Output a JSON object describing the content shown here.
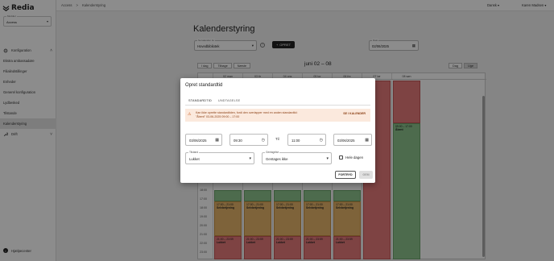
{
  "app": {
    "logo_text": "Redia"
  },
  "sidebar": {
    "access_label": "Moduler",
    "access_value": "Access",
    "items": [
      {
        "label": "Konfiguration",
        "icon": "gear-icon",
        "expandable": true
      },
      {
        "label": "Ekstra ambassadøre"
      },
      {
        "label": "Filialindstillinger"
      },
      {
        "label": "Enheder"
      },
      {
        "label": "Generel konfiguration"
      },
      {
        "label": "Lydbesked"
      },
      {
        "label": "Tilstande"
      },
      {
        "label": "Kalenderstyring",
        "active": true
      },
      {
        "label": "Drift",
        "icon": "wrench-icon",
        "expandable": true
      }
    ],
    "help_label": "Hjælpecenter"
  },
  "topbar": {
    "breadcrumb": [
      "Access",
      ">",
      "Kalenderstyring"
    ],
    "language": "Dansk",
    "user": "Karen Madsen"
  },
  "page": {
    "title": "Kalenderstyring",
    "calendar_select_label": "Se kalender for",
    "calendar_select_value": "Hovedbibliotek",
    "create_button": "OPRET",
    "date_label": "Dato",
    "date_value": "02/06/2025",
    "nav_buttons": [
      "I dag",
      "Tilbage",
      "Næste"
    ],
    "week_label": "juni 02 – 08",
    "view_buttons": [
      "Dag",
      "Uge"
    ],
    "day_headers": [
      "",
      "02 man",
      "03 tir",
      "04 ons",
      "05 tor",
      "06 fre",
      "07 lør",
      "08 søn"
    ],
    "hours": [
      "18:00",
      "17:00",
      "18:00",
      "19:00",
      "20:00",
      "21:00",
      "22:00",
      "23:00"
    ]
  },
  "calendar_events": {
    "closed_label": "Lukket",
    "self_service_label": "Selvbetjening",
    "open_label": "Åbent",
    "self_service_time": "17:00 – 21:00",
    "closed_time": "21:00 – 23:59",
    "open_time": "09:00 – 17:00"
  },
  "dialog": {
    "title": "Opret standardtid",
    "tabs": [
      "STANDARDTID",
      "UNDTAGELSE"
    ],
    "warning_line1": "Kan ikke oprette standardtiden, fordi den overlapper med en anden standardtid:",
    "warning_line2": "\"Åbent\" 03-06-2025 09:00 – 17:00",
    "warning_link": "SE I KALENDER",
    "start_date": "03/06/2025",
    "start_time": "09:30",
    "til_label": "Til",
    "end_time": "11:00",
    "end_date": "03/06/2025",
    "state_label": "Tilstand",
    "state_value": "Lukket",
    "repeat_label": "Gentagelse",
    "repeat_value": "Gentages ikke",
    "allday_label": "Hele dagen",
    "cancel_button": "FORTRYD",
    "save_button": "GEM"
  }
}
